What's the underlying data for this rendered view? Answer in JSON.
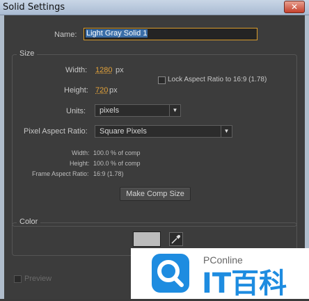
{
  "window": {
    "title": "Solid Settings",
    "close_glyph": "✕"
  },
  "name_field": {
    "label": "Name:",
    "value": "Light Gray Solid 1"
  },
  "size": {
    "group_title": "Size",
    "width_label": "Width:",
    "width_value": "1280",
    "width_unit": "px",
    "height_label": "Height:",
    "height_value": "720",
    "height_unit": "px",
    "lock_label": "Lock Aspect Ratio to 16:9 (1.78)",
    "units_label": "Units:",
    "units_value": "pixels",
    "par_label": "Pixel Aspect Ratio:",
    "par_value": "Square Pixels",
    "info_width_label": "Width:",
    "info_width_value": "100.0 % of comp",
    "info_height_label": "Height:",
    "info_height_value": "100.0 % of comp",
    "info_far_label": "Frame Aspect Ratio:",
    "info_far_value": "16:9 (1.78)",
    "make_comp_size": "Make Comp Size"
  },
  "color": {
    "group_title": "Color",
    "swatch_hex": "#bcbcbc"
  },
  "preview": {
    "label": "Preview"
  },
  "watermark": {
    "site": "PConline",
    "brand": "IT百科"
  }
}
